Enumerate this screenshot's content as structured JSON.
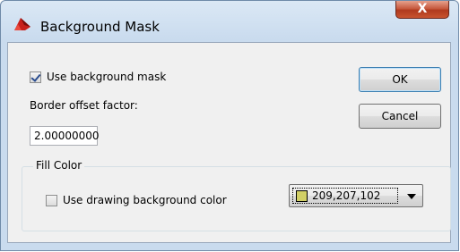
{
  "window": {
    "title": "Background Mask",
    "close_label": "X"
  },
  "mask": {
    "use_background_mask_label": "Use background mask",
    "use_background_mask_checked": true,
    "border_offset_label": "Border offset factor:",
    "border_offset_value": "2.00000000"
  },
  "buttons": {
    "ok_label": "OK",
    "cancel_label": "Cancel"
  },
  "fill_color": {
    "group_title": "Fill Color",
    "use_drawing_bg_label": "Use drawing background color",
    "use_drawing_bg_checked": false,
    "color_value": "209,207,102",
    "swatch_color": "#d1cf66"
  },
  "icons": {
    "app": "autocad-app-icon",
    "dropdown": "chevron-down-icon"
  }
}
